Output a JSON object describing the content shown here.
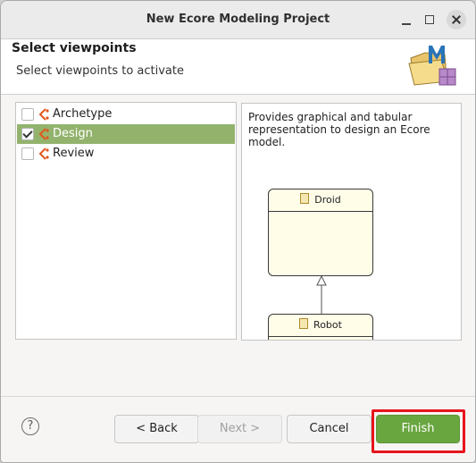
{
  "window": {
    "title": "New Ecore Modeling Project"
  },
  "header": {
    "title": "Select viewpoints",
    "subtitle": "Select viewpoints to activate",
    "icon": "sirius-wizard-icon"
  },
  "viewpoints": [
    {
      "label": "Archetype",
      "checked": false,
      "selected": false
    },
    {
      "label": "Design",
      "checked": true,
      "selected": true
    },
    {
      "label": "Review",
      "checked": false,
      "selected": false
    }
  ],
  "details": {
    "description": "Provides graphical and tabular representation to design an Ecore model.",
    "classes": [
      "Droid",
      "Robot"
    ]
  },
  "buttons": {
    "back": "< Back",
    "next": "Next >",
    "cancel": "Cancel",
    "finish": "Finish",
    "help": "?"
  },
  "colors": {
    "selection": "#93b36d",
    "finish": "#6aa640",
    "highlight": "#e6141b"
  }
}
